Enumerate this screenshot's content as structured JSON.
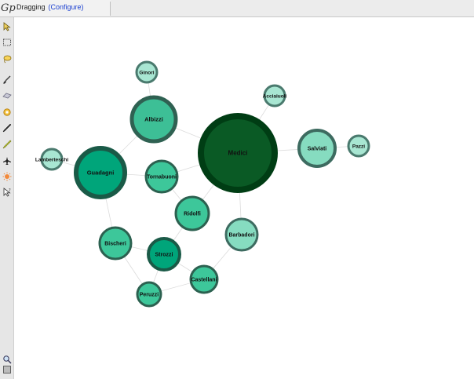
{
  "header": {
    "mode_label": "Dragging",
    "configure_label": "(Configure)",
    "logo_text": "Gp"
  },
  "toolbar": {
    "tools": [
      {
        "name": "pointer-tool",
        "icon": "cursor-arrow-icon"
      },
      {
        "name": "rect-select-tool",
        "icon": "selection-rectangle-icon"
      },
      {
        "name": "lasso-tool",
        "icon": "lasso-icon"
      },
      {
        "name": "brush-tool",
        "icon": "brush-icon"
      },
      {
        "name": "eraser-tool",
        "icon": "eraser-icon"
      },
      {
        "name": "drag-tool",
        "icon": "hand-icon"
      },
      {
        "name": "pencil-tool",
        "icon": "pencil-icon"
      },
      {
        "name": "highlighter-tool",
        "icon": "highlighter-icon"
      },
      {
        "name": "shortest-path-tool",
        "icon": "airplane-icon"
      },
      {
        "name": "heat-map-tool",
        "icon": "sun-icon"
      },
      {
        "name": "info-tool",
        "icon": "cursor-help-icon"
      },
      {
        "name": "zoom-tool",
        "icon": "magnifier-icon"
      },
      {
        "name": "frame-tool",
        "icon": "frame-icon"
      }
    ]
  },
  "graph": {
    "colors": {
      "edge": "#dcdcdc",
      "label": "#111111"
    },
    "nodes": [
      {
        "id": "medici",
        "label": "Medici",
        "degree": 6,
        "fill": "#0a5a25",
        "stroke": "#003d14"
      },
      {
        "id": "albizzi",
        "label": "Albizzi",
        "degree": 3,
        "fill": "#3dbf96",
        "stroke": "#2f6152"
      },
      {
        "id": "guadagni",
        "label": "Guadagni",
        "degree": 4,
        "fill": "#00a57a",
        "stroke": "#1a5a47"
      },
      {
        "id": "salviati",
        "label": "Salviati",
        "degree": 2,
        "fill": "#86dcc0",
        "stroke": "#3d6b60"
      },
      {
        "id": "tornabuoni",
        "label": "Tornabuoni",
        "degree": 3,
        "fill": "#3dc79a",
        "stroke": "#2c6150"
      },
      {
        "id": "ridolfi",
        "label": "Ridolfi",
        "degree": 3,
        "fill": "#3dc79a",
        "stroke": "#2c6150"
      },
      {
        "id": "barbadori",
        "label": "Barbadori",
        "degree": 2,
        "fill": "#86dcc0",
        "stroke": "#3d6b60"
      },
      {
        "id": "bischeri",
        "label": "Bischeri",
        "degree": 3,
        "fill": "#3dc79a",
        "stroke": "#2c6150"
      },
      {
        "id": "strozzi",
        "label": "Strozzi",
        "degree": 4,
        "fill": "#00a57a",
        "stroke": "#1a5a47"
      },
      {
        "id": "castellani",
        "label": "Castellani",
        "degree": 3,
        "fill": "#3dc79a",
        "stroke": "#2c6150"
      },
      {
        "id": "peruzzi",
        "label": "Peruzzi",
        "degree": 3,
        "fill": "#3dc79a",
        "stroke": "#2c6150"
      },
      {
        "id": "ginori",
        "label": "Ginori",
        "degree": 1,
        "fill": "#a8e6d2",
        "stroke": "#4a7a6e"
      },
      {
        "id": "acciaiuoli",
        "label": "Acciaiuoli",
        "degree": 1,
        "fill": "#a8e6d2",
        "stroke": "#4a7a6e"
      },
      {
        "id": "lamberteschi",
        "label": "Lamberteschi",
        "degree": 1,
        "fill": "#a8e6d2",
        "stroke": "#4a7a6e"
      },
      {
        "id": "pazzi",
        "label": "Pazzi",
        "degree": 1,
        "fill": "#a8e6d2",
        "stroke": "#4a7a6e"
      }
    ],
    "edges": [
      [
        "medici",
        "albizzi"
      ],
      [
        "medici",
        "salviati"
      ],
      [
        "medici",
        "acciaiuoli"
      ],
      [
        "medici",
        "tornabuoni"
      ],
      [
        "medici",
        "ridolfi"
      ],
      [
        "medici",
        "barbadori"
      ],
      [
        "albizzi",
        "ginori"
      ],
      [
        "albizzi",
        "guadagni"
      ],
      [
        "guadagni",
        "lamberteschi"
      ],
      [
        "guadagni",
        "tornabuoni"
      ],
      [
        "guadagni",
        "bischeri"
      ],
      [
        "tornabuoni",
        "ridolfi"
      ],
      [
        "ridolfi",
        "strozzi"
      ],
      [
        "salviati",
        "pazzi"
      ],
      [
        "barbadori",
        "castellani"
      ],
      [
        "bischeri",
        "strozzi"
      ],
      [
        "bischeri",
        "peruzzi"
      ],
      [
        "strozzi",
        "castellani"
      ],
      [
        "strozzi",
        "peruzzi"
      ],
      [
        "castellani",
        "peruzzi"
      ]
    ]
  }
}
